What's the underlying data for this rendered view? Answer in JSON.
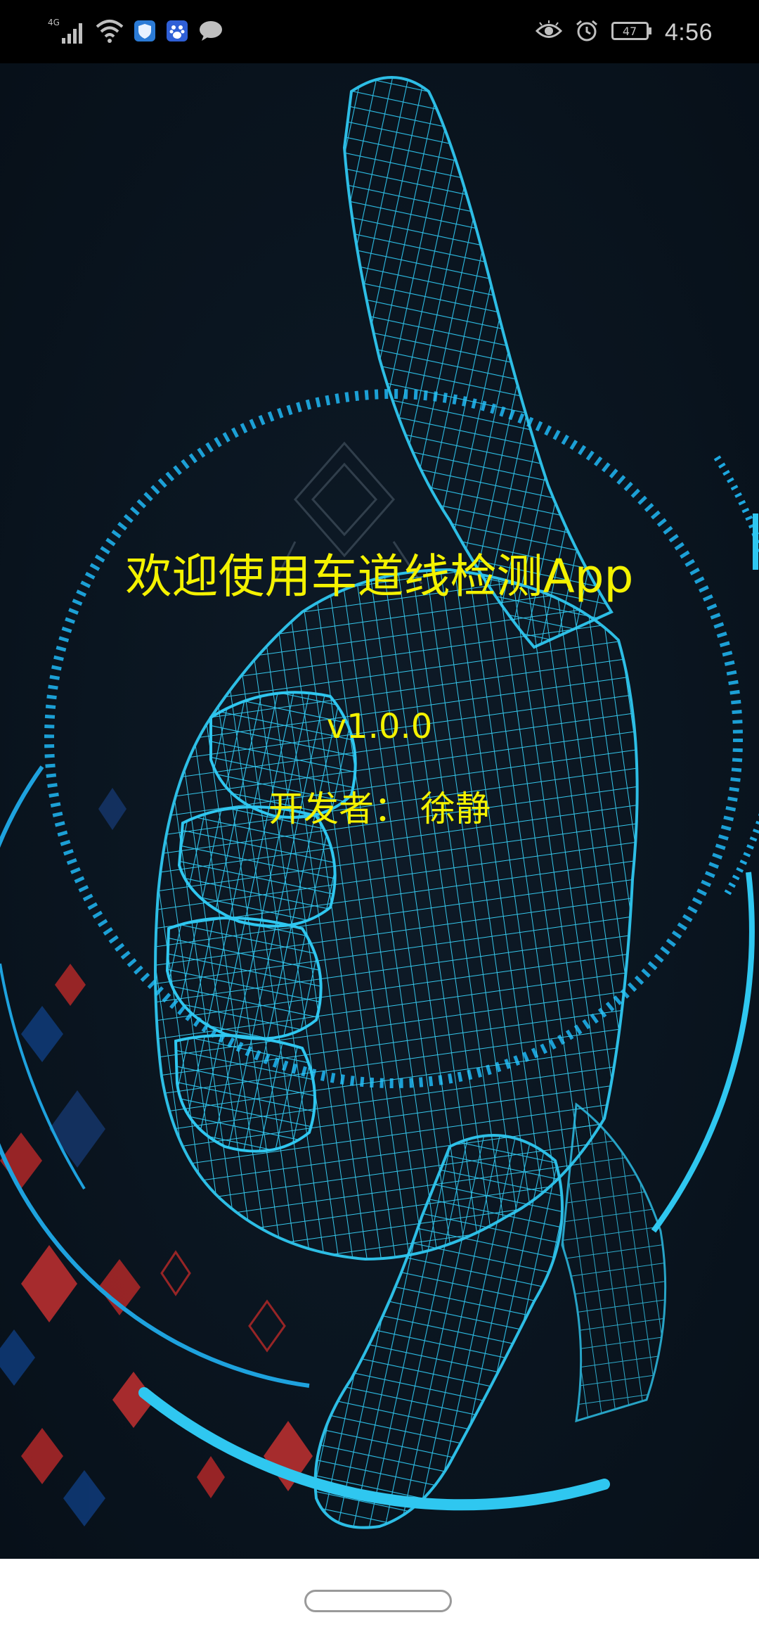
{
  "status_bar": {
    "network": "4G",
    "battery": "47",
    "time": "4:56",
    "icons_left": [
      "signal-icon",
      "wifi-icon",
      "shield-app-icon",
      "baidu-app-icon",
      "message-icon"
    ],
    "icons_right": [
      "eye-icon",
      "alarm-icon",
      "battery-icon"
    ]
  },
  "splash": {
    "title": "欢迎使用车道线检测App",
    "version": "v1.0.0",
    "developer": "开发者： 徐静",
    "colors": {
      "text": "#f4f200",
      "background": "#0b1520",
      "accent": "#2fc7f0"
    },
    "background_image": "wireframe-hand-pointing"
  },
  "nav_bar": {
    "home_indicator": "home-pill"
  }
}
